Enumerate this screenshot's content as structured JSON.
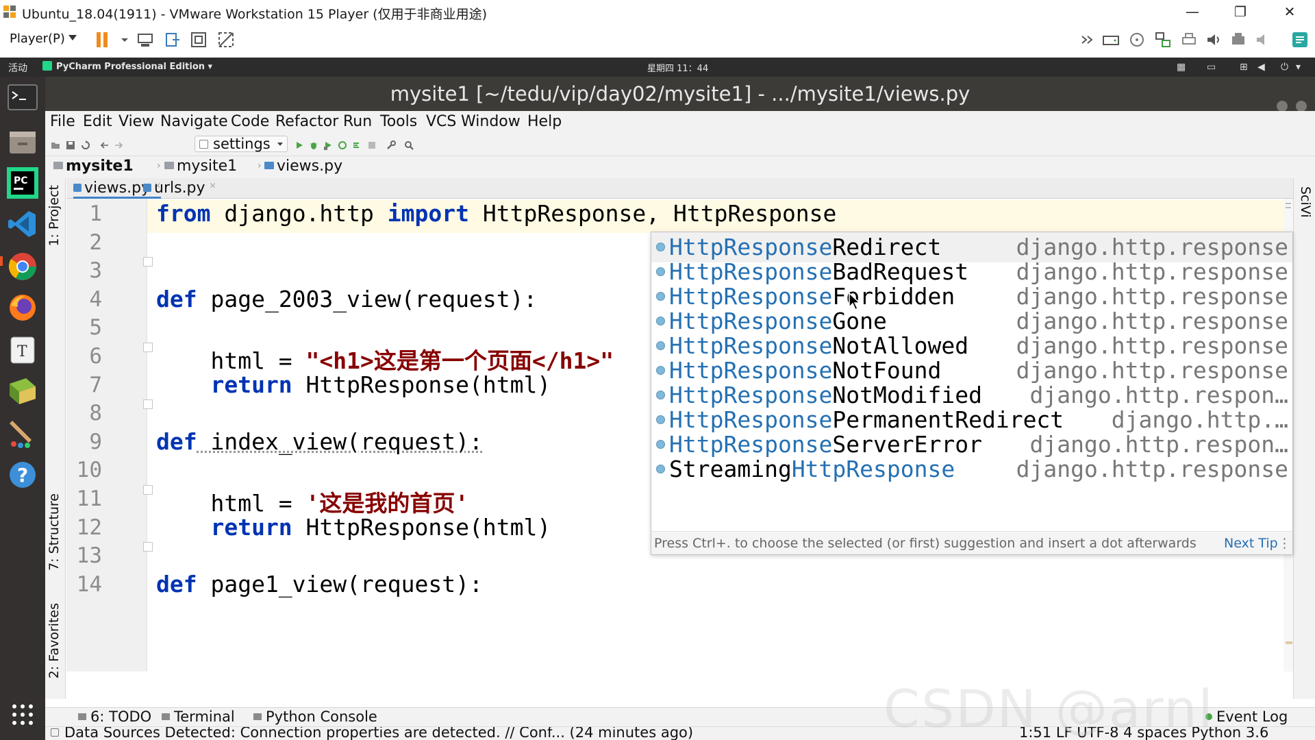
{
  "vm": {
    "title": "Ubuntu_18.04(1911) - VMware Workstation 15 Player (仅用于非商业用途)",
    "player_menu": "Player(P)",
    "win_min": "—",
    "win_max": "❐",
    "win_close": "✕"
  },
  "gnome": {
    "activities": "活动",
    "app_menu": "PyCharm Professional Edition ▾",
    "clock": "星期四 11：44"
  },
  "pycharm": {
    "title": "mysite1 [~/tedu/vip/day02/mysite1] - .../mysite1/views.py",
    "menu": [
      "File",
      "Edit",
      "View",
      "Navigate",
      "Code",
      "Refactor",
      "Run",
      "Tools",
      "VCS",
      "Window",
      "Help"
    ],
    "run_config": "settings",
    "breadcrumb": [
      "mysite1",
      "mysite1",
      "views.py"
    ],
    "left_tabs": [
      "1: Project",
      "7: Structure",
      "2: Favorites"
    ],
    "right_tab": "SciVi",
    "tabs": [
      {
        "label": "views.py",
        "active": true
      },
      {
        "label": "urls.py",
        "active": false
      }
    ]
  },
  "editor": {
    "line_numbers": [
      "1",
      "2",
      "3",
      "4",
      "5",
      "6",
      "7",
      "8",
      "9",
      "10",
      "11",
      "12",
      "13",
      "14"
    ],
    "lines": {
      "l1_kw1": "from",
      "l1_a": " django.http ",
      "l1_kw2": "import",
      "l1_b": " HttpResponse, ",
      "l1_c": "HttpResponse",
      "l4_kw": "def",
      "l4_a": " page_2003_view(request):",
      "l6_a": "    html = ",
      "l6_str": "\"<h1>这是第一个页面</h1>\"",
      "l7_kw": "    return",
      "l7_a": " HttpResponse(html)",
      "l9_kw": "def",
      "l9_a": " index_view(request):",
      "l11_a": "    html = ",
      "l11_str": "'这是我的首页'",
      "l12_kw": "    return",
      "l12_a": " HttpResponse(html)",
      "l14_kw": "def",
      "l14_a": " page1_view(request):"
    }
  },
  "completion": {
    "items": [
      {
        "match": "HttpResponse",
        "rest": "Redirect",
        "type": "django.http.response",
        "selected": true
      },
      {
        "match": "HttpResponse",
        "rest": "BadRequest",
        "type": "django.http.response"
      },
      {
        "match": "HttpResponse",
        "rest": "Forbidden",
        "type": "django.http.response"
      },
      {
        "match": "HttpResponse",
        "rest": "Gone",
        "type": "django.http.response"
      },
      {
        "match": "HttpResponse",
        "rest": "NotAllowed",
        "type": "django.http.response"
      },
      {
        "match": "HttpResponse",
        "rest": "NotFound",
        "type": "django.http.response"
      },
      {
        "match": "HttpResponse",
        "rest": "NotModified",
        "type": "django.http.respon…"
      },
      {
        "match": "HttpResponse",
        "rest": "PermanentRedirect",
        "type": "django.http.…"
      },
      {
        "match": "HttpResponse",
        "rest": "ServerError",
        "type": "django.http.respon…"
      },
      {
        "prefix": "Streaming",
        "match": "HttpResponse",
        "type": "django.http.response"
      }
    ],
    "hint": "Press Ctrl+. to choose the selected (or first) suggestion and insert a dot afterwards",
    "next_tip": "Next Tip",
    "menu": "⋮"
  },
  "bottom": {
    "todo": "6: TODO",
    "terminal": "Terminal",
    "python_console": "Python Console",
    "event_log": "Event Log"
  },
  "status": {
    "message": "Data Sources Detected: Connection properties are detected. // Conf... (24 minutes ago)",
    "right": "1:51  LF  UTF-8  4 spaces  Python 3.6"
  },
  "watermark": "CSDN @arnl"
}
